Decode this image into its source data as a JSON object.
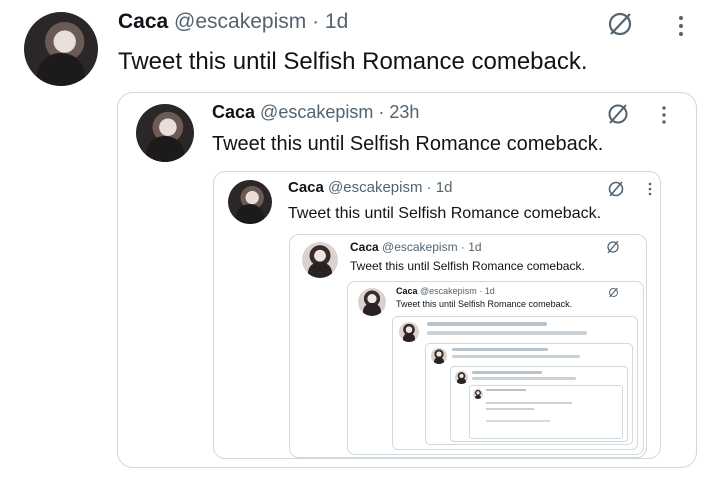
{
  "tweet": {
    "name": "Caca",
    "handle": "@escakepism",
    "time": "· 1d",
    "text": "Tweet this until Selfish Romance comeback."
  },
  "quote1": {
    "name": "Caca",
    "handle": "@escakepism",
    "time": "· 23h",
    "text": "Tweet this until Selfish Romance comeback."
  },
  "quote2": {
    "name": "Caca",
    "handle": "@escakepism",
    "time": "· 1d",
    "text": "Tweet this until Selfish Romance comeback."
  },
  "quote3": {
    "name": "Caca",
    "handle": "@escakepism",
    "time": "· 1d",
    "text": "Tweet this until Selfish Romance comeback."
  },
  "quote4": {
    "name": "Caca",
    "handle": "@escakepism",
    "time": "· 1d",
    "text": "Tweet this until Selfish Romance comeback."
  },
  "icons": {
    "grok": "grok-slash-circle-icon",
    "more": "more-vertical-icon"
  },
  "colors": {
    "text": "#0f1419",
    "secondary": "#536471",
    "border": "#cfd9de"
  }
}
